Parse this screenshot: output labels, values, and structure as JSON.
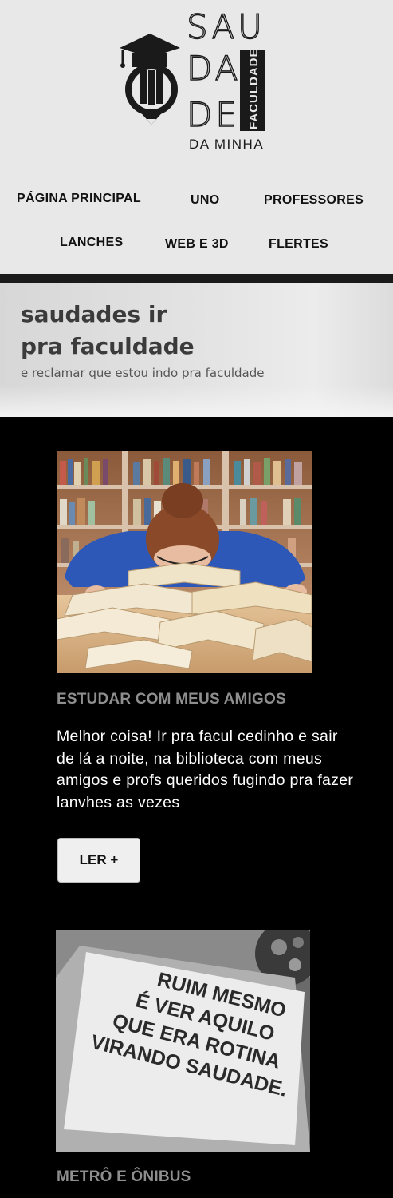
{
  "logo": {
    "line1": "SAU",
    "line2": "DA",
    "line3": "DE",
    "vertical": "FACULDADE",
    "bottom": "DA MINHA",
    "icon": "graduation-pencil-icon"
  },
  "nav": {
    "items": [
      {
        "label": "PÁGINA PRINCIPAL"
      },
      {
        "label": "UNO"
      },
      {
        "label": "PROFESSORES"
      },
      {
        "label": "LANCHES"
      },
      {
        "label": "WEB E 3D"
      },
      {
        "label": "FLERTES"
      }
    ]
  },
  "hero": {
    "title_line1": "saudades ir",
    "title_line2": "pra faculdade",
    "subtitle": "e reclamar que estou indo pra faculdade"
  },
  "posts": [
    {
      "title": "ESTUDAR COM MEUS AMIGOS",
      "text": "Melhor coisa! Ir pra facul cedinho e sair de lá a noite, na biblioteca com meus amigos e profs queridos fugindo pra fazer lanvhes as vezes",
      "button": "LER +"
    },
    {
      "image_text_1": "RUIM MESMO",
      "image_text_2": "É VER AQUILO",
      "image_text_3": "QUE ERA ROTINA",
      "image_text_4": "VIRANDO SAUDADE.",
      "title": "METRÔ E ÔNIBUS"
    }
  ],
  "colors": {
    "header_bg": "#e8e8e8",
    "page_bg": "#000000",
    "post_title": "#8e8e8e",
    "post_text": "#ffffff",
    "button_bg": "#efefef"
  }
}
